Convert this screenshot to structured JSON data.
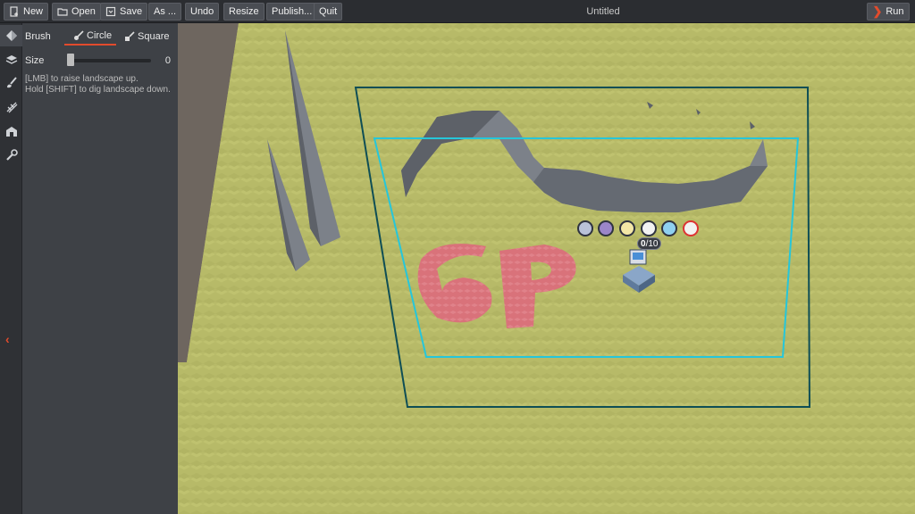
{
  "toolbar": {
    "new_label": "New",
    "open_label": "Open",
    "save_label": "Save",
    "save_as_label": "As ...",
    "undo_label": "Undo",
    "resize_label": "Resize",
    "publish_label": "Publish...",
    "quit_label": "Quit",
    "document_title": "Untitled",
    "run_label": "Run"
  },
  "rail": {
    "items": [
      {
        "icon": "terrain-icon",
        "active": true
      },
      {
        "icon": "layers-icon",
        "active": false
      },
      {
        "icon": "paintbrush-icon",
        "active": false
      },
      {
        "icon": "road-icon",
        "active": false
      },
      {
        "icon": "building-icon",
        "active": false
      },
      {
        "icon": "wrench-icon",
        "active": false
      }
    ],
    "collapse_icon": "chevron-left-icon"
  },
  "brush_panel": {
    "brush_label": "Brush",
    "modes": [
      {
        "label": "Circle",
        "icon": "brush-circle-icon",
        "selected": true
      },
      {
        "label": "Square",
        "icon": "brush-square-icon",
        "selected": false
      }
    ],
    "size_label": "Size",
    "size_value": "0",
    "hint_lines": [
      "[LMB] to raise landscape up.",
      "Hold [SHIFT] to dig landscape down."
    ]
  },
  "viewport": {
    "counter": {
      "current": "0",
      "max": "/10"
    },
    "hud_icons": [
      "citizen-icon",
      "worker-icon",
      "light-icon",
      "gear-icon",
      "crystal-icon",
      "no-entry-icon"
    ]
  },
  "colors": {
    "accent": "#e24b2c",
    "grass": "#b9bc6a",
    "outer_bounds": "#0f4e55",
    "inner_bounds": "#26c6da",
    "painted_tiles": "#d9727a",
    "rock": "#6e737b"
  }
}
